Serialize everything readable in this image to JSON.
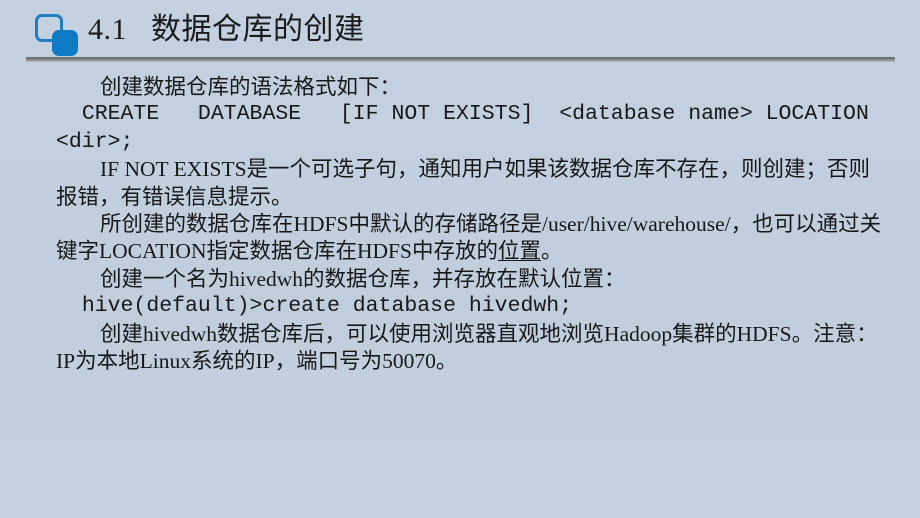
{
  "slide": {
    "background_color": "#c2cfdf",
    "accent_color": "#0f7ac4",
    "rule_color": "#6e6e6e"
  },
  "title": {
    "number": "4.1",
    "text": "4.1   数据仓库的创建",
    "icon": "two-rounded-squares-icon"
  },
  "body": {
    "paragraphs": [
      {
        "id": "p1",
        "style": "indent",
        "text": "创建数据仓库的语法格式如下："
      },
      {
        "id": "p2",
        "style": "code",
        "text": "  CREATE   DATABASE   [IF NOT EXISTS]  <database name> LOCATION <dir>;"
      },
      {
        "id": "p3",
        "style": "indent",
        "text": "IF NOT EXISTS是一个可选子句，通知用户如果该数据仓库不存在，则创建；否则报错，有错误信息提示。"
      },
      {
        "id": "p4",
        "style": "indent",
        "text": "所创建的数据仓库在HDFS中默认的存储路径是/user/hive/warehouse/，也可以通过关键字LOCATION指定数据仓库在HDFS中存放的",
        "underlined_tail": "位置",
        "tail": "。"
      },
      {
        "id": "p5",
        "style": "indent",
        "text": "创建一个名为hivedwh的数据仓库，并存放在默认位置："
      },
      {
        "id": "p6",
        "style": "code",
        "text": "  hive(default)>create database hivedwh;"
      },
      {
        "id": "p7",
        "style": "indent",
        "text": "创建hivedwh数据仓库后，可以使用浏览器直观地浏览Hadoop集群的HDFS。注意：IP为本地Linux系统的IP，端口号为50070。"
      }
    ]
  }
}
